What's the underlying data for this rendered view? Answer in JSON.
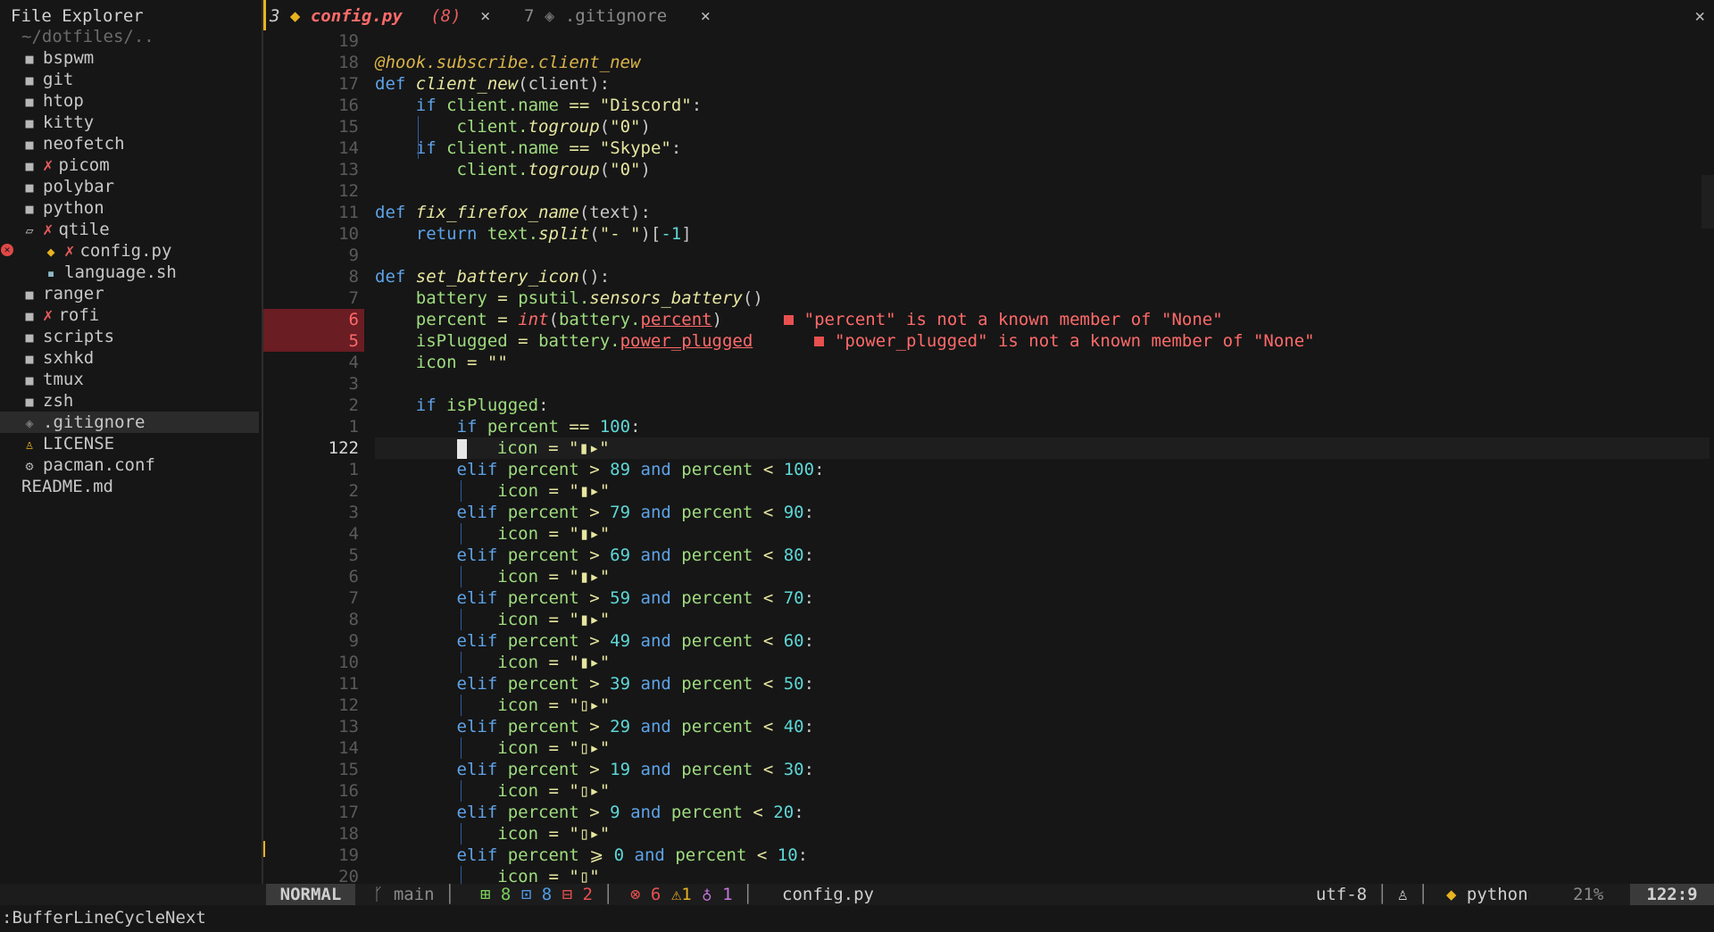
{
  "explorer": {
    "title": "File Explorer",
    "root": "~/dotfiles/..",
    "items": [
      {
        "label": "bspwm",
        "type": "dir"
      },
      {
        "label": "git",
        "type": "dir"
      },
      {
        "label": "htop",
        "type": "dir"
      },
      {
        "label": "kitty",
        "type": "dir"
      },
      {
        "label": "neofetch",
        "type": "dir"
      },
      {
        "label": "picom",
        "type": "dir",
        "flag": "✗"
      },
      {
        "label": "polybar",
        "type": "dir"
      },
      {
        "label": "python",
        "type": "dir"
      },
      {
        "label": "qtile",
        "type": "dir-open",
        "flag": "✗"
      },
      {
        "label": "config.py",
        "type": "python",
        "flag": "✗"
      },
      {
        "label": "language.sh",
        "type": "shell"
      },
      {
        "label": "ranger",
        "type": "dir"
      },
      {
        "label": "rofi",
        "type": "dir",
        "flag": "✗"
      },
      {
        "label": "scripts",
        "type": "dir"
      },
      {
        "label": "sxhkd",
        "type": "dir"
      },
      {
        "label": "tmux",
        "type": "dir"
      },
      {
        "label": "zsh",
        "type": "dir"
      },
      {
        "label": ".gitignore",
        "type": "git"
      },
      {
        "label": "LICENSE",
        "type": "license"
      },
      {
        "label": "pacman.conf",
        "type": "config"
      },
      {
        "label": "README.md",
        "type": "md"
      }
    ]
  },
  "tabs": {
    "active": {
      "num": "3",
      "name": "config.py",
      "count": "(8)",
      "close": "×"
    },
    "inactive": {
      "num": "7",
      "name": ".gitignore",
      "close": "×"
    },
    "window_close": "✕"
  },
  "editor": {
    "line_numbers": [
      "19",
      "18",
      "17",
      "16",
      "15",
      "14",
      "13",
      "12",
      "11",
      "10",
      "9",
      "8",
      "7",
      "6",
      "5",
      "4",
      "3",
      "2",
      "1",
      "122",
      "1",
      "2",
      "3",
      "4",
      "5",
      "6",
      "7",
      "8",
      "9",
      "10",
      "11",
      "12",
      "13",
      "14",
      "15",
      "16",
      "17",
      "18",
      "19",
      "20"
    ],
    "diagnostics": {
      "percent": "\"percent\" is not a known member of \"None\"",
      "power_plugged": "\"power_plugged\" is not a known member of \"None\""
    }
  },
  "status": {
    "mode": "NORMAL",
    "branch": "main",
    "git_added": "8",
    "git_modified": "8",
    "git_removed": "2",
    "errors": "6",
    "warnings": "1",
    "hints": "1",
    "file": "config.py",
    "encoding": "utf-8",
    "filetype": "python",
    "percent": "21%",
    "position": "122:9"
  },
  "command_line": ":BufferLineCycleNext",
  "colors": {
    "background": "#161616",
    "error": "#e85050",
    "accent": "#e9b320"
  }
}
